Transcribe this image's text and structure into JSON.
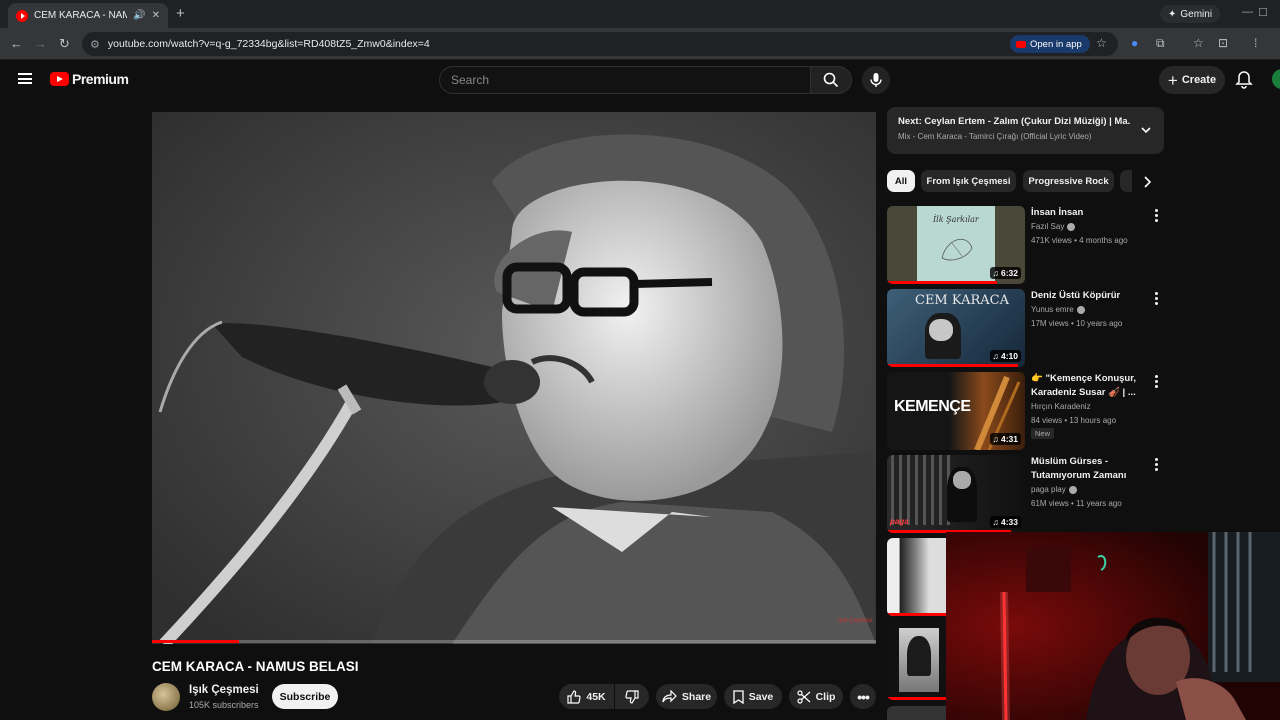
{
  "browser": {
    "tab_title": "CEM KARACA - NAMUS BELASI",
    "url": "youtube.com/watch?v=q-g_72334bg&list=RD408tZ5_Zmw0&index=4",
    "gemini_label": "Gemini",
    "open_in_app_label": "Open in app"
  },
  "header": {
    "logo_text": "Premium",
    "search_placeholder": "Search",
    "create_label": "Create"
  },
  "video": {
    "title": "CEM KARACA - NAMUS BELASI",
    "watermark": "Işık Çeşmesi",
    "progress": 0.12
  },
  "channel": {
    "name": "Işık Çeşmesi",
    "subscribers": "105K subscribers",
    "subscribe_label": "Subscribe"
  },
  "actions": {
    "likes": "45K",
    "share": "Share",
    "save": "Save",
    "clip": "Clip"
  },
  "next": {
    "line": "Next: Ceylan Ertem - Zalım (Çukur Dizi Müziği) | Ma...",
    "mix": "Mix - Cem Karaca - Tamirci Çırağı (Official Lyric Video)"
  },
  "chips": [
    "All",
    "From Işık Çeşmesi",
    "Progressive Rock"
  ],
  "recommendations": [
    {
      "title": "İnsan İnsan",
      "channel": "Fazıl Say",
      "meta": "471K views • 4 months ago",
      "duration": "6:32",
      "thumb_text": "İlk Şarkılar",
      "watched": 0.8
    },
    {
      "title": "Deniz Üstü Köpürür",
      "channel": "Yunus emre",
      "meta": "17M views • 10 years ago",
      "duration": "4:10",
      "thumb_text": "CEM KARACA",
      "watched": 0.95
    },
    {
      "title": "👉 \"Kemençe Konuşur, Karadeniz Susar 🎻 | ...",
      "channel": "Hırçın Karadeniz",
      "meta": "84 views • 13 hours ago",
      "badge": "New",
      "duration": "4:31",
      "thumb_text": "KEMENÇE",
      "watched": 0
    },
    {
      "title": "Müslüm Gürses - Tutamıyorum Zamanı",
      "channel": "paga play",
      "meta": "61M views • 11 years ago",
      "duration": "4:33",
      "thumb_text": "paga",
      "watched": 0.9
    }
  ],
  "colors": {
    "background": "#0f0f0f",
    "youtube_red": "#ff0000",
    "chip_bg": "#272727"
  }
}
